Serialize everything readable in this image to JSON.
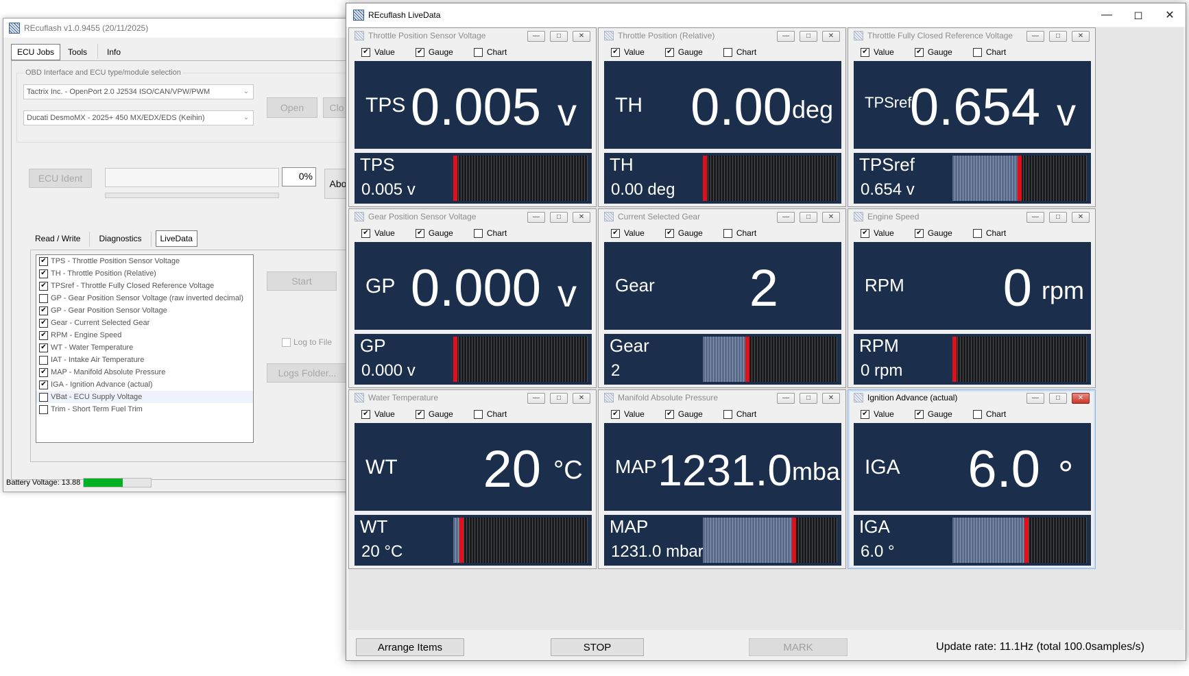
{
  "main_window": {
    "title": "REcuflash  v1.0.9455 (20/11/2025)",
    "tabs": [
      "ECU Jobs",
      "Tools",
      "Info"
    ],
    "group_title": "OBD Interface and ECU type/module selection",
    "interface_combo": "Tactrix Inc. - OpenPort 2.0 J2534 ISO/CAN/VPW/PWM",
    "ecu_combo": "Ducati DesmoMX - 2025+ 450 MX/EDX/EDS (Keihin)",
    "open_button": "Open",
    "close_button": "Clo",
    "ecu_ident_button": "ECU Ident",
    "progress_percent": "0%",
    "abort_button": "Abo",
    "sub_tabs": [
      "Read / Write",
      "Diagnostics",
      "LiveData"
    ],
    "start_button": "Start",
    "log_to_file": "Log to File",
    "logs_folder_button": "Logs Folder...",
    "battery_label": "Battery Voltage: 13.88",
    "battery_fraction": 0.58,
    "channels": [
      {
        "label": "TPS - Throttle Position Sensor Voltage",
        "checked": true
      },
      {
        "label": "TH - Throttle Position (Relative)",
        "checked": true
      },
      {
        "label": "TPSref - Throttle Fully Closed Reference Voltage",
        "checked": true
      },
      {
        "label": "GP - Gear Position Sensor Voltage (raw inverted decimal)",
        "checked": false
      },
      {
        "label": "GP - Gear Position Sensor Voltage",
        "checked": true
      },
      {
        "label": "Gear - Current Selected Gear",
        "checked": true
      },
      {
        "label": "RPM - Engine Speed",
        "checked": true
      },
      {
        "label": "WT - Water Temperature",
        "checked": true
      },
      {
        "label": "IAT - Intake Air Temperature",
        "checked": false
      },
      {
        "label": "MAP - Manifold Absolute Pressure",
        "checked": true
      },
      {
        "label": "IGA - Ignition Advance (actual)",
        "checked": true
      },
      {
        "label": "VBat - ECU Supply Voltage",
        "checked": false
      },
      {
        "label": "Trim - Short Term Fuel Trim",
        "checked": false
      }
    ]
  },
  "live_window": {
    "title": "REcuflash LiveData",
    "option_labels": {
      "value": "Value",
      "gauge": "Gauge",
      "chart": "Chart"
    },
    "items": [
      {
        "title": "Throttle Position Sensor Voltage",
        "label": "TPS",
        "value": "0.005",
        "unit": "v",
        "gauge_label": "TPS",
        "gauge_value": "0.005   v",
        "fill": 0.0,
        "marker": 0.0,
        "active": false,
        "value_checked": true,
        "gauge_checked": true,
        "chart_checked": false
      },
      {
        "title": "Throttle Position (Relative)",
        "label": "TH",
        "value": "0.00",
        "unit": "deg",
        "gauge_label": "TH",
        "gauge_value": "0.00 deg",
        "fill": 0.0,
        "marker": 0.0,
        "active": false,
        "value_checked": true,
        "gauge_checked": true,
        "chart_checked": false
      },
      {
        "title": "Throttle Fully Closed Reference Voltage",
        "label": "TPSref",
        "value": "0.654",
        "unit": "v",
        "gauge_label": "TPSref",
        "gauge_value": "0.654   v",
        "fill": 0.5,
        "marker": 0.5,
        "active": false,
        "value_checked": true,
        "gauge_checked": true,
        "chart_checked": false
      },
      {
        "title": "Gear Position Sensor Voltage",
        "label": "GP",
        "value": "0.000",
        "unit": "v",
        "gauge_label": "GP",
        "gauge_value": "0.000   v",
        "fill": 0.0,
        "marker": 0.0,
        "active": false,
        "value_checked": true,
        "gauge_checked": true,
        "chart_checked": false
      },
      {
        "title": "Current Selected Gear",
        "label": "Gear",
        "value": "2",
        "unit": "",
        "gauge_label": "Gear",
        "gauge_value": "2",
        "fill": 0.33,
        "marker": 0.33,
        "active": false,
        "value_checked": true,
        "gauge_checked": true,
        "chart_checked": false
      },
      {
        "title": "Engine Speed",
        "label": "RPM",
        "value": "0",
        "unit": "rpm",
        "gauge_label": "RPM",
        "gauge_value": "0 rpm",
        "fill": 0.0,
        "marker": 0.0,
        "active": false,
        "value_checked": true,
        "gauge_checked": true,
        "chart_checked": false
      },
      {
        "title": "Water Temperature",
        "label": "WT",
        "value": "20",
        "unit": "°C",
        "gauge_label": "WT",
        "gauge_value": "20   °C",
        "fill": 0.06,
        "marker": 0.06,
        "active": false,
        "value_checked": true,
        "gauge_checked": true,
        "chart_checked": false
      },
      {
        "title": "Manifold Absolute Pressure",
        "label": "MAP",
        "value": "1231.0",
        "unit": "mbar",
        "gauge_label": "MAP",
        "gauge_value": "1231.0 mbar",
        "fill": 0.68,
        "marker": 0.68,
        "active": false,
        "value_checked": true,
        "gauge_checked": true,
        "chart_checked": false
      },
      {
        "title": "Ignition Advance (actual)",
        "label": "IGA",
        "value": "6.0",
        "unit": "°",
        "gauge_label": "IGA",
        "gauge_value": "6.0   °",
        "fill": 0.55,
        "marker": 0.55,
        "active": true,
        "value_checked": true,
        "gauge_checked": true,
        "chart_checked": false
      }
    ],
    "footer": {
      "arrange_button": "Arrange Items",
      "stop_button": "STOP",
      "mark_button": "MARK",
      "update_rate": "Update rate: 11.1Hz (total 100.0samples/s)"
    }
  }
}
